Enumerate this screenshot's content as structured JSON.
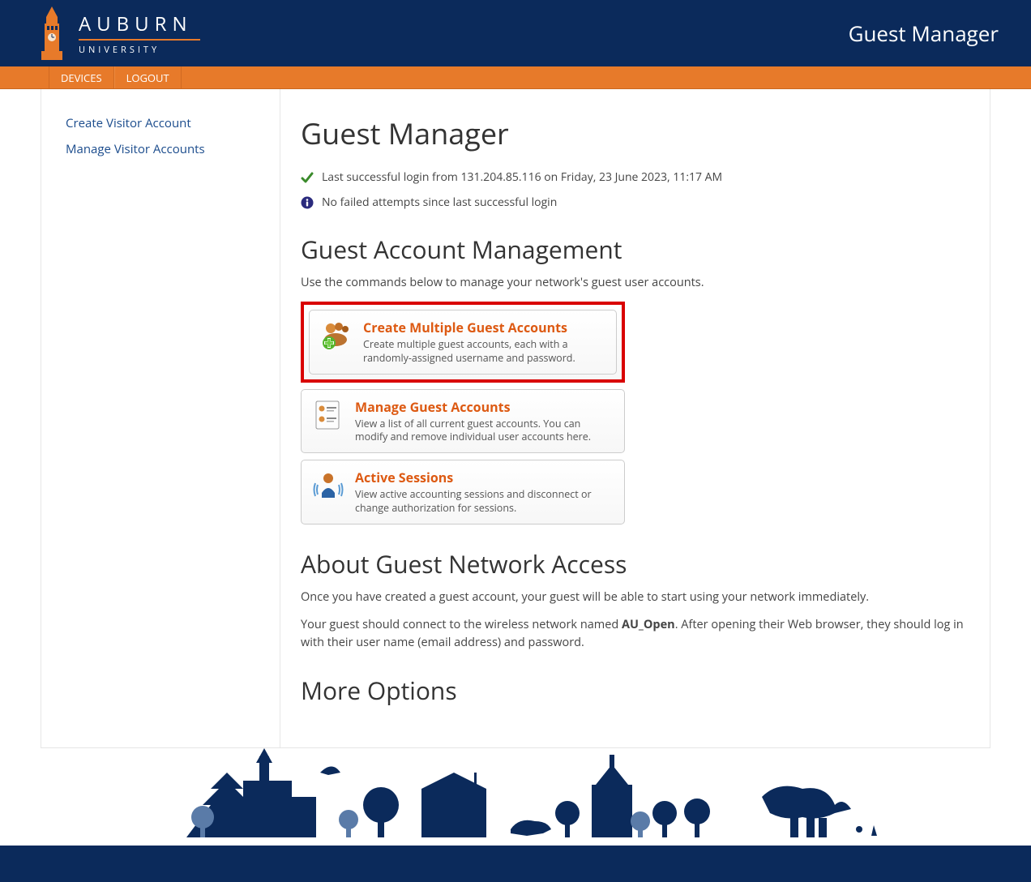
{
  "header": {
    "logo_main": "AUBURN",
    "logo_sub": "UNIVERSITY",
    "app_title": "Guest Manager"
  },
  "nav": {
    "devices": "DEVICES",
    "logout": "LOGOUT"
  },
  "sidebar": {
    "create_visitor": "Create Visitor Account",
    "manage_visitors": "Manage Visitor Accounts"
  },
  "main": {
    "title": "Guest Manager",
    "login_status": "Last successful login from 131.204.85.116 on Friday, 23 June 2023, 11:17 AM",
    "failed_status": "No failed attempts since last successful login",
    "section_mgmt": "Guest Account Management",
    "mgmt_desc": "Use the commands below to manage your network's guest user accounts.",
    "cards": {
      "create_multi": {
        "title": "Create Multiple Guest Accounts",
        "desc": "Create multiple guest accounts, each with a randomly-assigned username and password."
      },
      "manage_guest": {
        "title": "Manage Guest Accounts",
        "desc": "View a list of all current guest accounts. You can modify and remove individual user accounts here."
      },
      "active_sessions": {
        "title": "Active Sessions",
        "desc": "View active accounting sessions and disconnect or change authorization for sessions."
      }
    },
    "section_about": "About Guest Network Access",
    "about_p1": "Once you have created a guest account, your guest will be able to start using your network immediately.",
    "about_p2_a": "Your guest should connect to the wireless network named ",
    "about_p2_bold": "AU_Open",
    "about_p2_b": ". After opening their Web browser, they should log in with their user name (email address) and password.",
    "section_more": "More Options"
  }
}
